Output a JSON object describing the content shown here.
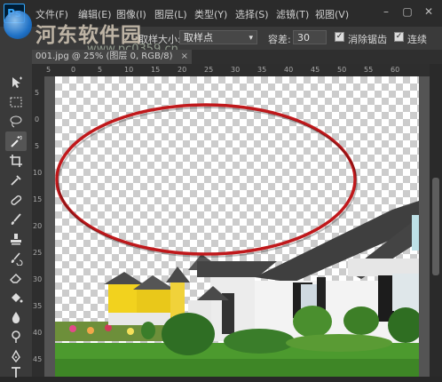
{
  "app": {
    "logo": "Ps"
  },
  "menu": [
    "文件(F)",
    "编辑(E)",
    "图像(I)",
    "图层(L)",
    "类型(Y)",
    "选择(S)",
    "滤镜(T)",
    "视图(V)"
  ],
  "watermark": {
    "title": "河东软件园",
    "url": "www.pc0359.cn"
  },
  "options": {
    "sample_size_label": "取样大小:",
    "sample_size_value": "取样点",
    "tolerance_label": "容差:",
    "tolerance_value": "30",
    "antialias_label": "消除锯齿",
    "contiguous_label": "连续"
  },
  "document_tab": {
    "title": "001.jpg @ 25% (图层 0, RGB/8)",
    "close": "×"
  },
  "ruler": {
    "top": [
      "5",
      "0",
      "5",
      "10",
      "15",
      "20",
      "25",
      "30",
      "35",
      "40",
      "45",
      "50",
      "55",
      "60"
    ],
    "left": [
      "5",
      "0",
      "5",
      "10",
      "15",
      "20",
      "25",
      "30",
      "35",
      "40",
      "45"
    ]
  },
  "tools": [
    "move-tool",
    "marquee-tool",
    "lasso-tool",
    "magic-wand-tool",
    "crop-tool",
    "eyedropper-tool",
    "healing-brush-tool",
    "brush-tool",
    "clone-stamp-tool",
    "history-brush-tool",
    "eraser-tool",
    "paint-bucket-tool",
    "blur-tool",
    "dodge-tool",
    "pen-tool",
    "type-tool"
  ],
  "colors": {
    "annotation_ellipse": "#c0181b",
    "accent": "#31a8ff"
  }
}
